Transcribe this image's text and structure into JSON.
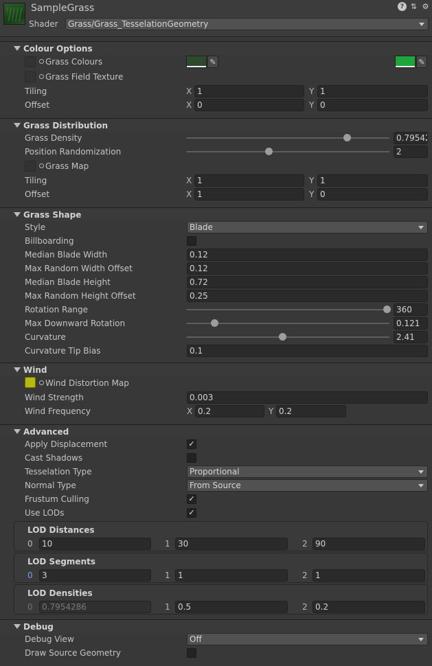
{
  "header": {
    "title": "SampleGrass",
    "shader_label": "Shader",
    "shader_value": "Grass/Grass_TesselationGeometry",
    "icons": [
      "help-icon",
      "sliders-icon",
      "gear-icon"
    ]
  },
  "colour": {
    "title": "Colour Options",
    "grass_colours": "Grass Colours",
    "grass_field_texture": "Grass Field Texture",
    "tiling": "Tiling",
    "tiling_x": "1",
    "tiling_y": "1",
    "offset": "Offset",
    "offset_x": "0",
    "offset_y": "0",
    "colour1": "#2d4a2d",
    "colour2": "#1fa53a"
  },
  "distribution": {
    "title": "Grass Distribution",
    "density_label": "Grass Density",
    "density_value": "0.79542",
    "randomization_label": "Position Randomization",
    "randomization_value": "2",
    "grass_map": "Grass Map",
    "tiling": "Tiling",
    "tiling_x": "1",
    "tiling_y": "1",
    "offset": "Offset",
    "offset_x": "1",
    "offset_y": "0"
  },
  "shape": {
    "title": "Grass Shape",
    "style_label": "Style",
    "style_value": "Blade",
    "billboarding": "Billboarding",
    "median_width_label": "Median Blade Width",
    "median_width": "0.12",
    "max_width_label": "Max Random Width Offset",
    "max_width": "0.12",
    "median_height_label": "Median Blade Height",
    "median_height": "0.72",
    "max_height_label": "Max Random Height Offset",
    "max_height": "0.25",
    "rotation_label": "Rotation Range",
    "rotation": "360",
    "downward_label": "Max Downward Rotation",
    "downward": "0.121",
    "curvature_label": "Curvature",
    "curvature": "2.41",
    "tip_bias_label": "Curvature Tip Bias",
    "tip_bias": "0.1"
  },
  "wind": {
    "title": "Wind",
    "distortion_map": "Wind Distortion Map",
    "strength_label": "Wind Strength",
    "strength": "0.003",
    "frequency_label": "Wind Frequency",
    "freq_x": "0.2",
    "freq_y": "0.2"
  },
  "advanced": {
    "title": "Advanced",
    "apply_displacement": "Apply Displacement",
    "cast_shadows": "Cast Shadows",
    "tesselation_label": "Tesselation Type",
    "tesselation_value": "Proportional",
    "normal_label": "Normal Type",
    "normal_value": "From Source",
    "frustum_culling": "Frustum Culling",
    "use_lods": "Use LODs",
    "lod_distances": {
      "title": "LOD Distances",
      "values": [
        "10",
        "30",
        "90"
      ]
    },
    "lod_segments": {
      "title": "LOD Segments",
      "values": [
        "3",
        "1",
        "1"
      ]
    },
    "lod_densities": {
      "title": "LOD Densities",
      "values": [
        "0.7954286",
        "0.5",
        "0.2"
      ]
    }
  },
  "debug": {
    "title": "Debug",
    "view_label": "Debug View",
    "view_value": "Off",
    "draw_source": "Draw Source Geometry"
  },
  "common": {
    "x": "X",
    "y": "Y",
    "i0": "0",
    "i1": "1",
    "i2": "2",
    "check": "✓"
  }
}
